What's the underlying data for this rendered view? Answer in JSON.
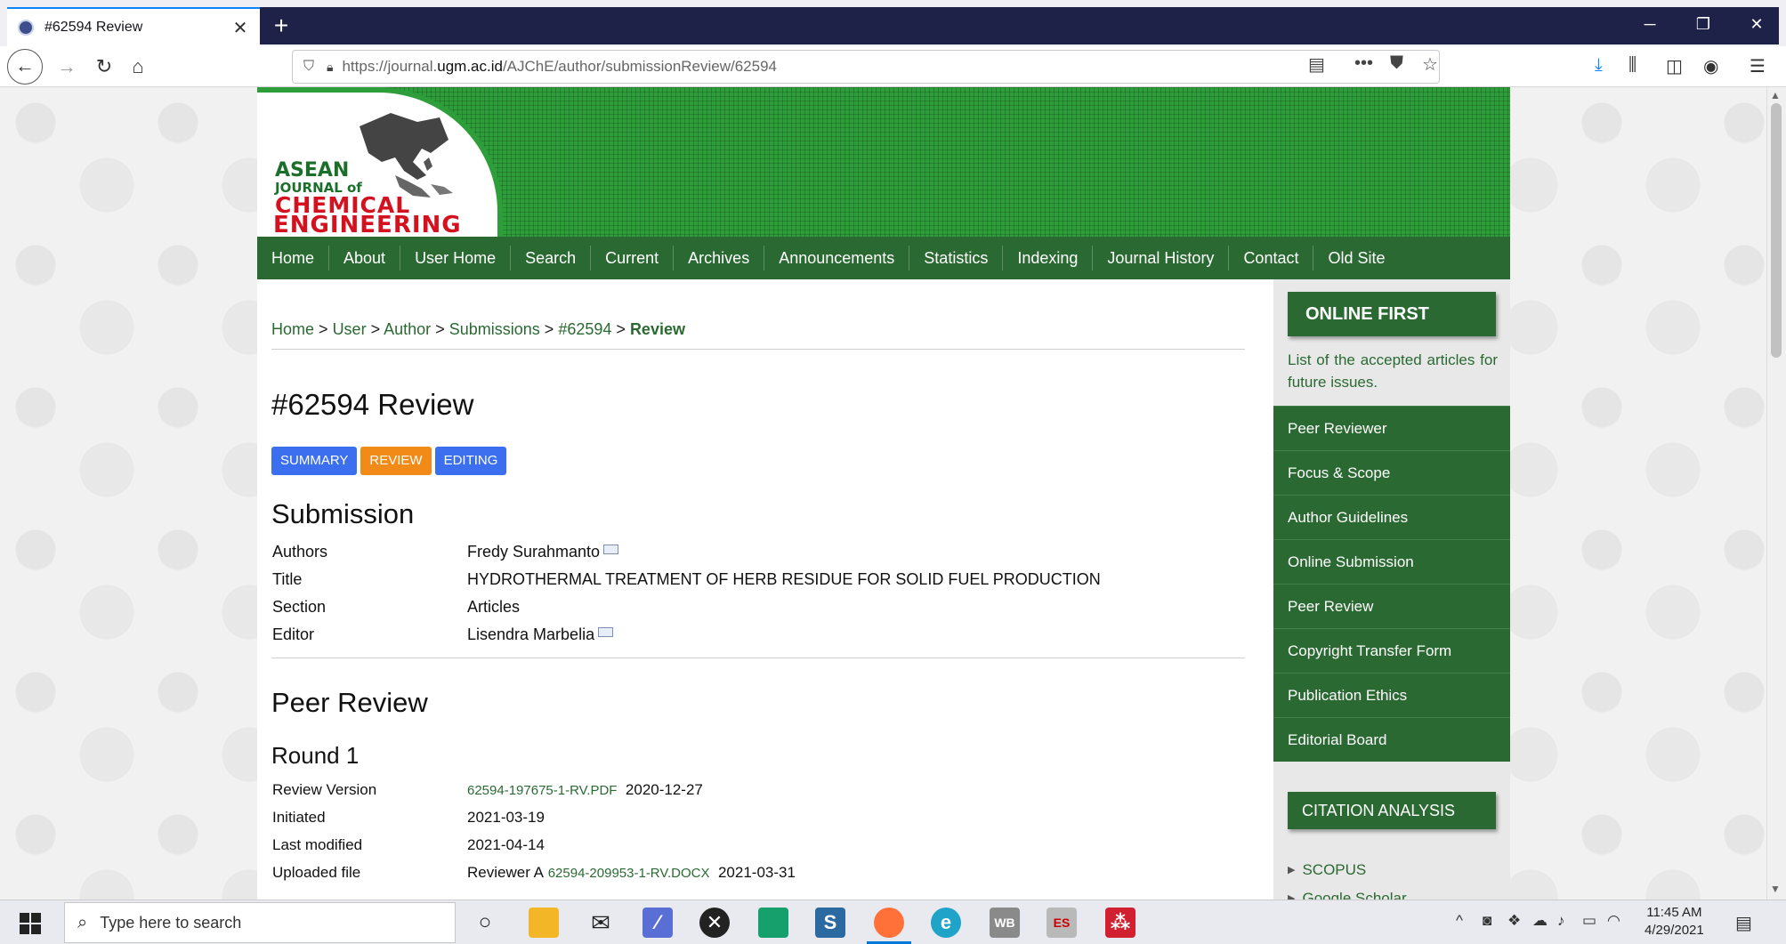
{
  "browser": {
    "tab_title": "#62594 Review",
    "tab_close": "✕",
    "new_tab": "+",
    "url_prefix": "https://journal.",
    "url_domain": "ugm.ac.id",
    "url_path": "/AJChE/author/submissionReview/62594"
  },
  "logo": {
    "line1": "ASEAN",
    "line2": "JOURNAL of",
    "line3": "CHEMICAL",
    "line4": "ENGINEERING"
  },
  "menu": [
    "Home",
    "About",
    "User Home",
    "Search",
    "Current",
    "Archives",
    "Announcements",
    "Statistics",
    "Indexing",
    "Journal History",
    "Contact",
    "Old Site"
  ],
  "breadcrumb": {
    "items": [
      "Home",
      "User",
      "Author",
      "Submissions",
      "#62594"
    ],
    "separator": ">",
    "current": "Review"
  },
  "page_title": "#62594 Review",
  "subtabs": [
    "SUMMARY",
    "REVIEW",
    "EDITING"
  ],
  "submission": {
    "heading": "Submission",
    "authors_label": "Authors",
    "authors_value": "Fredy Surahmanto",
    "title_label": "Title",
    "title_value": "HYDROTHERMAL TREATMENT OF HERB RESIDUE FOR SOLID FUEL PRODUCTION",
    "section_label": "Section",
    "section_value": "Articles",
    "editor_label": "Editor",
    "editor_value": "Lisendra Marbelia"
  },
  "peer_review": {
    "heading": "Peer Review",
    "round_heading": "Round 1",
    "review_version_label": "Review Version",
    "review_version_file": "62594-197675-1-RV.PDF",
    "review_version_date": "2020-12-27",
    "initiated_label": "Initiated",
    "initiated_value": "2021-03-19",
    "last_modified_label": "Last modified",
    "last_modified_value": "2021-04-14",
    "uploaded_label": "Uploaded file",
    "uploaded_reviewer": "Reviewer A",
    "uploaded_file": "62594-209953-1-RV.DOCX",
    "uploaded_date": "2021-03-31"
  },
  "sidebar": {
    "online_first": "ONLINE FIRST",
    "online_first_desc": "List of the accepted articles for future issues.",
    "links": [
      "Peer Reviewer",
      "Focus & Scope",
      "Author Guidelines",
      "Online Submission",
      "Peer Review",
      "Copyright Transfer Form",
      "Publication Ethics",
      "Editorial Board"
    ],
    "citation_heading": "CITATION ANALYSIS",
    "citation_items": [
      "SCOPUS",
      "Google Scholar"
    ]
  },
  "taskbar": {
    "search_placeholder": "Type here to search",
    "time": "11:45 AM",
    "date": "4/29/2021"
  },
  "colors": {
    "brand_green": "#2a6a32",
    "banner_green": "#2e9e3a",
    "tab_blue": "#3b6ff0",
    "tab_orange": "#f28a17",
    "logo_red": "#d4111e"
  }
}
